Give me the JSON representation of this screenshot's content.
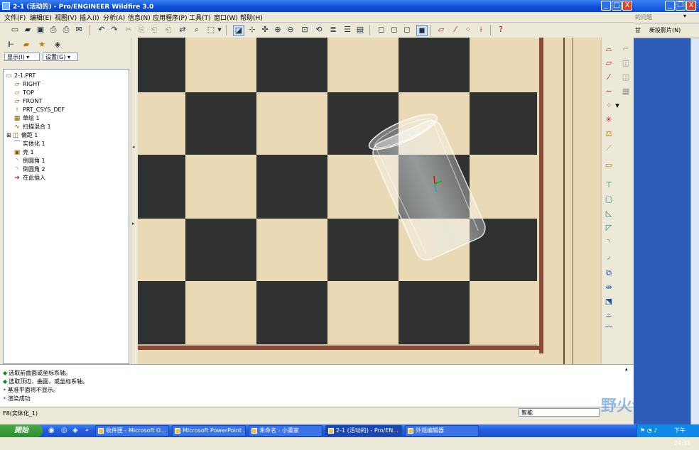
{
  "window": {
    "title": "2-1 (活动的) - Pro/ENGINEER Wildfire 3.0",
    "minimize": "_",
    "maximize": "□",
    "close": "X"
  },
  "menu": [
    "文件(F)",
    "编辑(E)",
    "视图(V)",
    "插入(I)",
    "分析(A)",
    "信息(N)",
    "应用程序(P)",
    "工具(T)",
    "窗口(W)",
    "帮助(H)"
  ],
  "left_panel": {
    "show_label": "显示(I) ▾",
    "settings_label": "设置(G) ▾",
    "tree": [
      {
        "label": "2-1.PRT",
        "icon": "part-icon",
        "glyph": "▭"
      },
      {
        "label": "RIGHT",
        "icon": "datum-plane-icon",
        "glyph": "▱"
      },
      {
        "label": "TOP",
        "icon": "datum-plane-icon",
        "glyph": "▱"
      },
      {
        "label": "FRONT",
        "icon": "datum-plane-icon",
        "glyph": "▱"
      },
      {
        "label": "PRT_CSYS_DEF",
        "icon": "csys-icon",
        "glyph": "⟊"
      },
      {
        "label": "草绘 1",
        "icon": "sketch-icon",
        "glyph": "▦"
      },
      {
        "label": "扫描混合 1",
        "icon": "swept-blend-icon",
        "glyph": "∿"
      },
      {
        "label": "偏距 1",
        "icon": "offset-icon",
        "glyph": "◫"
      },
      {
        "label": "实体化 1",
        "icon": "solidify-icon",
        "glyph": "⌒"
      },
      {
        "label": "壳 1",
        "icon": "shell-icon",
        "glyph": "▣"
      },
      {
        "label": "倒圆角 1",
        "icon": "round-icon",
        "glyph": "◝"
      },
      {
        "label": "倒圆角 2",
        "icon": "round-icon",
        "glyph": "◝"
      },
      {
        "label": "在此插入",
        "icon": "insert-here-icon",
        "glyph": "➔"
      }
    ]
  },
  "messages": [
    "选取前曲面或坐标系轴。",
    "选取顶边，曲面，或坐标系轴。",
    "基准平面将不显示。",
    "渲染成功"
  ],
  "status": {
    "feature": "F8(实体化_1)",
    "filter": "智能"
  },
  "right_window": {
    "help_text": "的问题",
    "new_slide": "新投影片(N)"
  },
  "watermark": "野火论坛",
  "taskbar": {
    "start": "開始",
    "tasks": [
      "收件匣 - Microsoft O...",
      "Microsoft PowerPoint ...",
      "未命名 - 小畫家",
      "2-1 (活动的) - Pro/EN...",
      "外观编辑器"
    ],
    "clock": "下午 04:38"
  },
  "colors": {
    "title_blue": "#0a4fd6",
    "board_light": "#e9d9b5",
    "board_dark": "#2f3230",
    "board_border": "#8a4a3a",
    "taskbar_blue": "#245edb",
    "start_green": "#2f8c2f"
  }
}
